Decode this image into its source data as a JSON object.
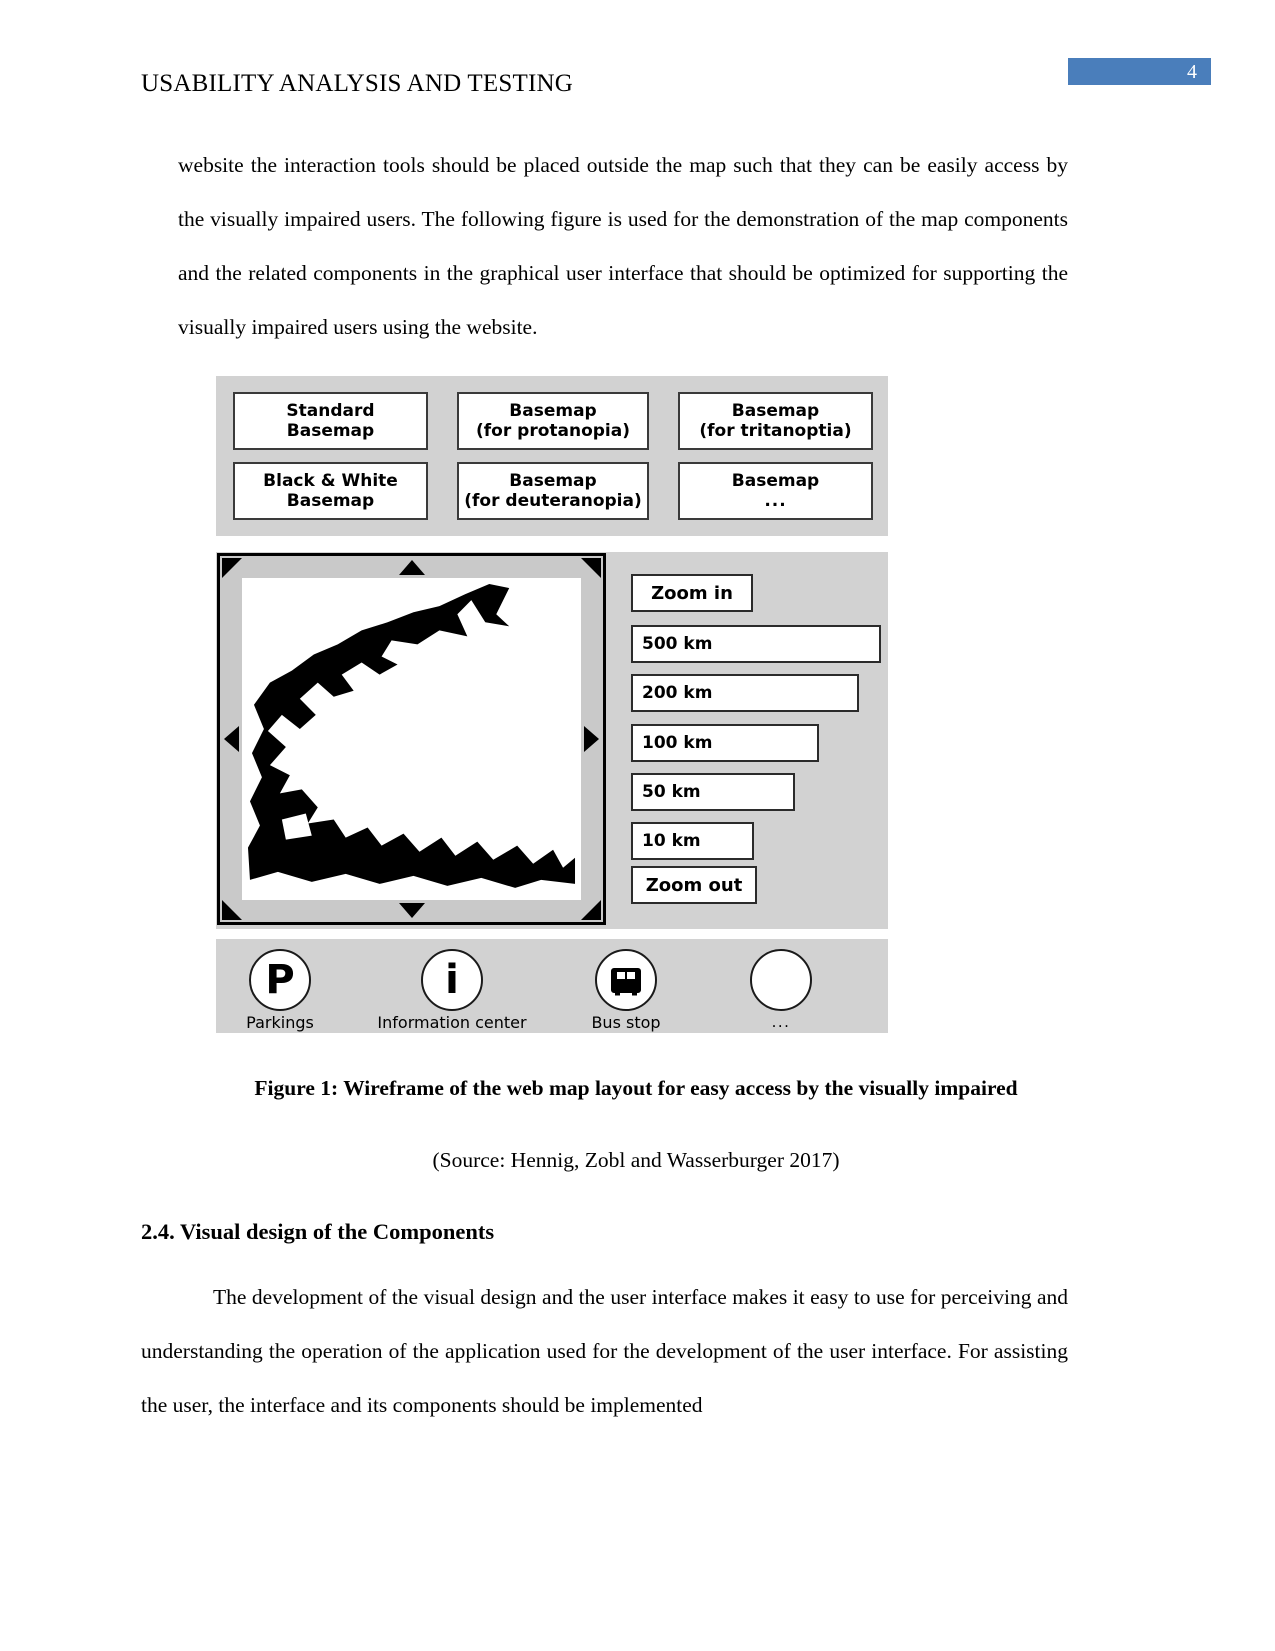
{
  "header": {
    "title": "USABILITY ANALYSIS AND TESTING",
    "page_number": "4",
    "page_number_bg": "#4a7ebb"
  },
  "body": {
    "paragraph_1": "website the interaction tools should be placed outside the map such that they can be easily access by the visually impaired users. The following figure is used for the demonstration of the map components and the related components in the graphical user interface that should be optimized for supporting the visually impaired users using the website.",
    "section_heading": "2.4. Visual design of the Components",
    "paragraph_2": "The development of the visual design and the user interface makes it easy to use for perceiving and understanding the operation of the application used for the development of the user interface. For assisting the user, the interface and its components should be implemented"
  },
  "figure": {
    "caption": "Figure 1: Wireframe of the web map layout for easy access by the visually impaired",
    "source": "(Source: Hennig, Zobl and Wasserburger 2017)",
    "basemaps": [
      {
        "line1": "Standard",
        "line2": "Basemap"
      },
      {
        "line1": "Basemap",
        "line2": "(for protanopia)"
      },
      {
        "line1": "Basemap",
        "line2": "(for tritanoptia)"
      },
      {
        "line1": "Black & White",
        "line2": "Basemap"
      },
      {
        "line1": "Basemap",
        "line2": "(for deuteranopia)"
      },
      {
        "line1": "Basemap",
        "line2": "..."
      }
    ],
    "zoom_controls": {
      "zoom_in": "Zoom in",
      "zoom_out": "Zoom out",
      "scales": [
        "500 km",
        "200 km",
        "100 km",
        "50 km",
        "10 km"
      ]
    },
    "poi": [
      {
        "label": "Parkings",
        "glyph": "P",
        "icon": "parking-icon"
      },
      {
        "label": "Information center",
        "glyph": "i",
        "icon": "information-icon"
      },
      {
        "label": "Bus stop",
        "glyph": "",
        "icon": "bus-icon"
      },
      {
        "label": "...",
        "glyph": "",
        "icon": "empty-icon"
      }
    ]
  }
}
